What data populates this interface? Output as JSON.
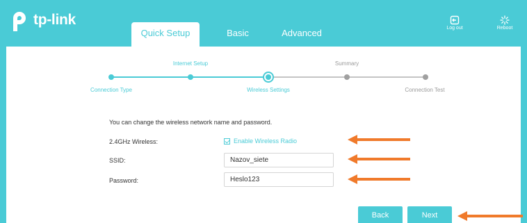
{
  "brand": {
    "logo_text": "tp-link"
  },
  "tabs": [
    {
      "label": "Quick Setup",
      "active": true
    },
    {
      "label": "Basic",
      "active": false
    },
    {
      "label": "Advanced",
      "active": false
    }
  ],
  "header_buttons": {
    "logout": "Log out",
    "reboot": "Reboot"
  },
  "progress": {
    "steps_top": [
      "Internet Setup",
      "Summary"
    ],
    "steps_bottom": [
      "Connection Type",
      "Wireless Settings",
      "Connection Test"
    ],
    "current_step": "Wireless Settings"
  },
  "form": {
    "intro": "You can change the wireless network name and password.",
    "wireless_label": "2.4GHz Wireless:",
    "enable_radio_label": "Enable Wireless Radio",
    "enable_radio_checked": true,
    "ssid_label": "SSID:",
    "ssid_value": "Nazov_siete",
    "password_label": "Password:",
    "password_value": "Heslo123"
  },
  "buttons": {
    "back": "Back",
    "next": "Next"
  },
  "colors": {
    "accent": "#4acbd6",
    "arrow": "#f07a2b"
  }
}
